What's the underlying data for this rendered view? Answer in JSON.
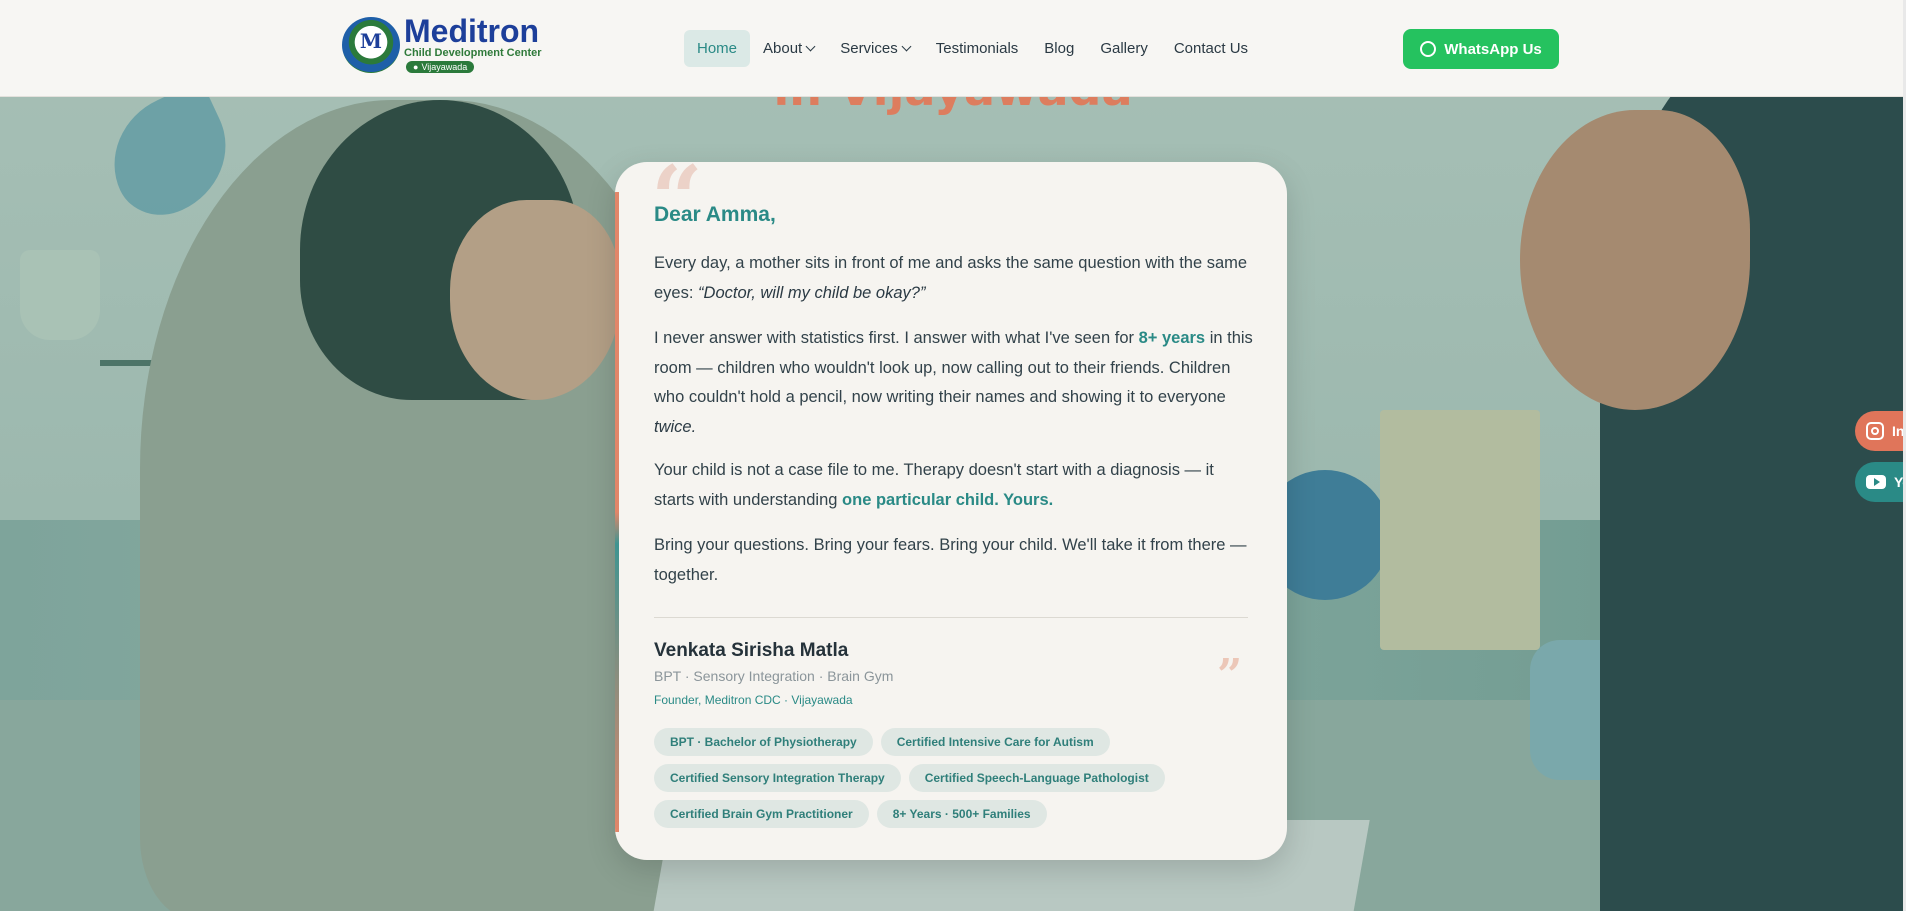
{
  "header": {
    "logo": {
      "name": "Meditron",
      "subtitle": "Child Development Center",
      "badge": "Vijayawada"
    },
    "nav": [
      {
        "label": "Home",
        "active": true,
        "dropdown": false
      },
      {
        "label": "About",
        "active": false,
        "dropdown": true
      },
      {
        "label": "Services",
        "active": false,
        "dropdown": true
      },
      {
        "label": "Testimonials",
        "active": false,
        "dropdown": false
      },
      {
        "label": "Blog",
        "active": false,
        "dropdown": false
      },
      {
        "label": "Gallery",
        "active": false,
        "dropdown": false
      },
      {
        "label": "Contact Us",
        "active": false,
        "dropdown": false
      }
    ],
    "cta": {
      "label": "WhatsApp Us",
      "icon": "whatsapp-icon"
    }
  },
  "hero": {
    "title_partial": "in Vijayawada"
  },
  "letter": {
    "greeting": "Dear Amma,",
    "p1_text": "Every day, a mother sits in front of me and asks the same question with the same eyes: ",
    "p1_quote": "“Doctor, will my child be okay?”",
    "p2_a": "I never answer with statistics first. I answer with what I've seen for ",
    "p2_highlight": "8+ years",
    "p2_b": " in this room — children who wouldn't look up, now calling out to their friends. Children who couldn't hold a pencil, now writing their names and showing it to everyone ",
    "p2_em": "twice.",
    "p3_a": "Your child is not a case file to me. Therapy doesn't start with a diagnosis — it starts with understanding ",
    "p3_highlight": "one particular child. Yours.",
    "p4": "Bring your questions. Bring your fears. Bring your child. We'll take it from there — together.",
    "signature": {
      "name": "Venkata Sirisha Matla",
      "qualifications": "BPT · Sensory Integration · Brain Gym",
      "role": "Founder, Meditron CDC · Vijayawada"
    },
    "tags": [
      "BPT · Bachelor of Physiotherapy",
      "Certified Intensive Care for Autism",
      "Certified Sensory Integration Therapy",
      "Certified Speech-Language Pathologist",
      "Certified Brain Gym Practitioner",
      "8+ Years · 500+ Families"
    ]
  },
  "social": [
    {
      "label": "Instagram",
      "icon": "instagram-icon",
      "color": "#e0755a"
    },
    {
      "label": "YouTube",
      "icon": "youtube-icon",
      "color": "#2a8a86"
    }
  ],
  "colors": {
    "accent_teal": "#2a8a86",
    "accent_coral": "#e07a5a",
    "whatsapp_green": "#25c25f",
    "brand_blue": "#1d3f9a"
  }
}
